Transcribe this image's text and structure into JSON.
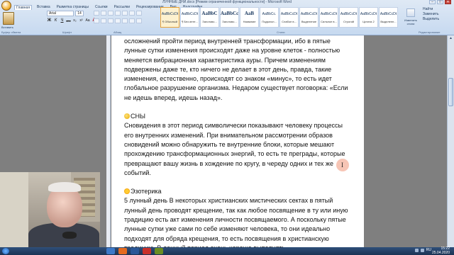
{
  "window": {
    "title": "ЛУННЫЕ ДНИ.docx [Режим ограниченной функциональности] - Microsoft Word",
    "controls": [
      "–",
      "□",
      "✕"
    ]
  },
  "ribbon": {
    "tabs": [
      "Главная",
      "Вставка",
      "Разметка страницы",
      "Ссылки",
      "Рассылки",
      "Рецензирование",
      "Вид",
      "Надстройки"
    ],
    "active_tab": "Главная",
    "font_name": "Arial",
    "font_size": "14",
    "paste_label": "Вставить",
    "format_buttons": [
      "Ж",
      "К",
      "Ч",
      "abc",
      "x₂",
      "x²",
      "Aa",
      "A"
    ],
    "styles": [
      {
        "sample": "AaBbCcDt",
        "name": "¶ Обычный",
        "selected": true
      },
      {
        "sample": "AaBbCcDt",
        "name": "¶ Без инте...",
        "selected": false
      },
      {
        "sample": "AaBbC",
        "name": "Заголово...",
        "selected": false,
        "big": true
      },
      {
        "sample": "AaBbCc",
        "name": "Заголово...",
        "selected": false,
        "big": true
      },
      {
        "sample": "AaB",
        "name": "Название",
        "selected": false,
        "big": true
      },
      {
        "sample": "AaBbCc.",
        "name": "Подзагол...",
        "selected": false
      },
      {
        "sample": "AaBbCcDt",
        "name": "Слабое в...",
        "selected": false
      },
      {
        "sample": "AaBbCcDt",
        "name": "Выделение",
        "selected": false
      },
      {
        "sample": "AaBbCcDt",
        "name": "Сильное в...",
        "selected": false
      },
      {
        "sample": "AaBbCcDt",
        "name": "Строгий",
        "selected": false
      },
      {
        "sample": "AaBbCcDt",
        "name": "Цитата 2",
        "selected": false
      },
      {
        "sample": "AaBbCcDt",
        "name": "Выделенн...",
        "selected": false
      },
      {
        "sample": "AaBbCcDt",
        "name": "Слабая сс...",
        "selected": false
      }
    ],
    "change_styles_label": "Изменить стили",
    "editing": [
      "Найти",
      "Заменить",
      "Выделить"
    ],
    "groups": [
      "Буфер обмена",
      "Шрифт",
      "Абзац",
      "Стили",
      "Редактирование"
    ]
  },
  "document": {
    "paragraph1": "осложнений пройти период внутренней трансформации, ибо в пятые лунные сутки изменения происходят даже на уровне клеток - полностью меняется вибрационная характеристика ауры. Причем изменениям подвержены даже те, кто ничего не делает в этот день, правда, такие изменения, естественно, происходят со знаком «минус», то есть идет глобальное разрушение организма. Недаром существует поговорка: «Если не идешь вперед, идешь назад».",
    "heading_dreams": "СНЫ",
    "paragraph_dreams": "Сновидения в этот период символически показывают человеку процессы его внутренних изменений. При внимательном рассмотрении образов сновидений можно обнаружить те внутренние блоки, которые мешают прохождению трансформационных энергий, то есть те преграды, которые превращают вашу жизнь в хождение по кругу, в череду одних и тех же событий.",
    "heading_esoterics": "Эзотерика",
    "paragraph_esoterics": "5 лунный день В некоторых христианских мистических сектах в пятый лунный день проводят крещение, так как любое посвящение в ту или иную традицию есть акт изменения личности посвящаемого. А поскольку пятые лунные сутки уже сами по себе изменяют человека, то они идеально подходят для обряда крещения, то есть посвящения в христианскую традицию. В данный период очень хорошо выполнять"
  },
  "taskbar": {
    "time": "15:22",
    "date": "25.04.2020",
    "language": "RU"
  },
  "colors": {
    "ribbon": "#c6d9f0",
    "document_bg": "#7f7f7f",
    "page": "#ffffff",
    "taskbar": "#1b3354",
    "cursor_highlight": "#f0967880"
  }
}
